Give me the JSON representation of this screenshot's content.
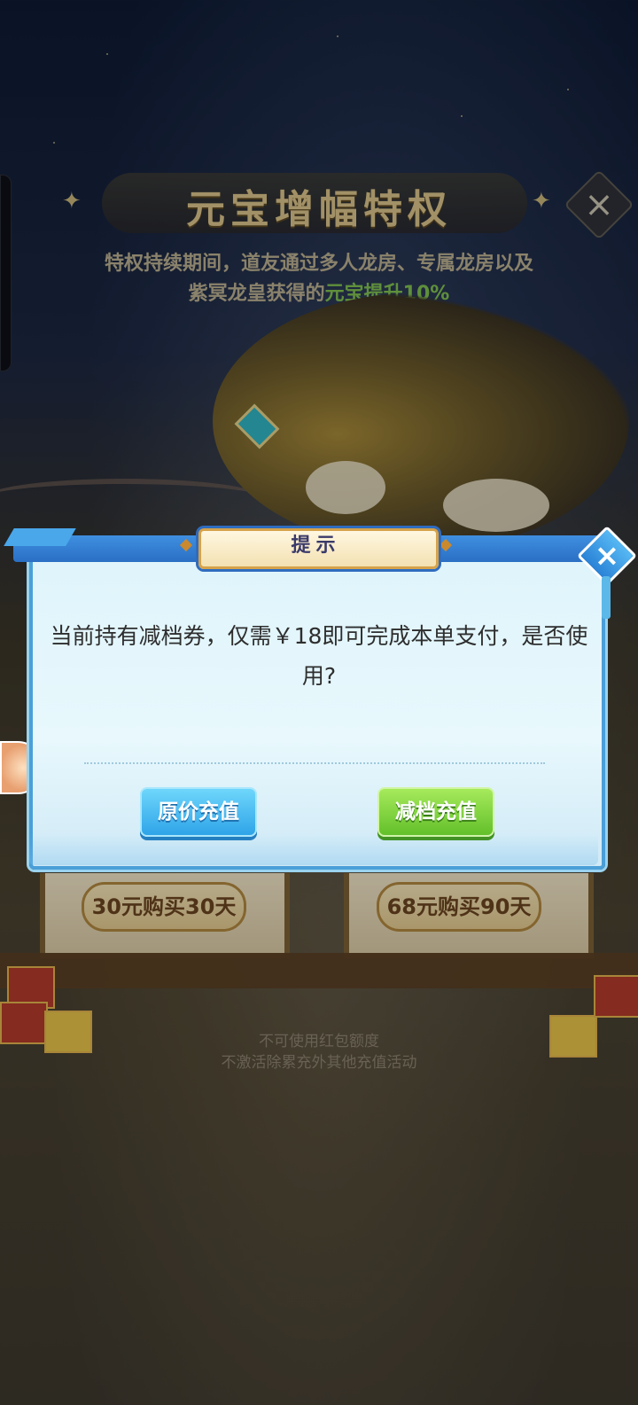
{
  "background": {
    "title": "元宝增幅特权",
    "description_line1": "特权持续期间，道友通过多人龙房、专属龙房以及",
    "description_line2_prefix": "紫冥龙皇获得的",
    "description_line2_highlight": "元宝提升10%",
    "offer_left": "30元购买30天",
    "offer_right": "68元购买90天",
    "note_line1": "不可使用红包额度",
    "note_line2": "不激活除累充外其他充值活动"
  },
  "dialog": {
    "title": "提示",
    "message": "当前持有减档券，仅需￥18即可完成本单支付，是否使用?",
    "button_original": "原价充值",
    "button_reduced": "减档充值"
  },
  "icons": {
    "close": "×"
  },
  "colors": {
    "highlight": "#7fbf4f",
    "dialog_border": "#4a9fd8",
    "button_blue": "#2ea4e8",
    "button_green": "#63c02a"
  }
}
